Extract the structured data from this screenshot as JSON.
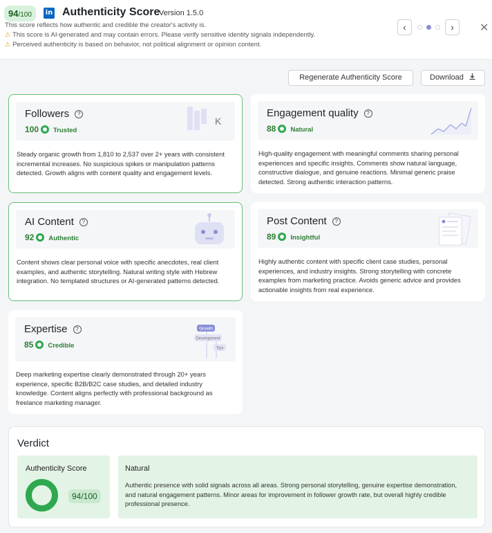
{
  "header": {
    "score_main": "94",
    "score_denominator": "/100",
    "linkedin_icon": "in",
    "title": "Authenticity Score",
    "version": "Version 1.5.0",
    "line1": "This score reflects how authentic and credible the creator's activity is.",
    "warning1": "This score is AI-generated and may contain errors. Please verify sensitive identity signals independently.",
    "warning2": "Perceived authenticity is based on behavior, not political alignment or opinion content.",
    "warning_icon": "⚠",
    "prev_icon": "‹",
    "next_icon": "›",
    "close_icon": "✕",
    "pager_active_index": 2
  },
  "actions": {
    "regenerate_label": "Regenerate Authenticity Score",
    "download_label": "Download"
  },
  "cards": {
    "followers": {
      "title": "Followers",
      "score": "100",
      "tag": "Trusted",
      "illus_letter": "K",
      "desc": "Steady organic growth from 1,810 to 2,537 over 2+ years with consistent incremental increases. No suspicious spikes or manipulation patterns detected. Growth aligns with content quality and engagement levels."
    },
    "engagement": {
      "title": "Engagement quality",
      "score": "88",
      "tag": "Natural",
      "desc": "High-quality engagement with meaningful comments sharing personal experiences and specific insights. Comments show natural language, constructive dialogue, and genuine reactions. Minimal generic praise detected. Strong authentic interaction patterns."
    },
    "ai_content": {
      "title": "AI Content",
      "score": "92",
      "tag": "Authentic",
      "desc": "Content shows clear personal voice with specific anecdotes, real client examples, and authentic storytelling. Natural writing style with Hebrew integration. No templated structures or AI-generated patterns detected."
    },
    "post_content": {
      "title": "Post Content",
      "score": "89",
      "tag": "Insightful",
      "desc": "Highly authentic content with specific client case studies, personal experiences, and industry insights. Strong storytelling with concrete examples from marketing practice. Avoids generic advice and provides actionable insights from real experience."
    },
    "expertise": {
      "title": "Expertise",
      "score": "85",
      "tag": "Credible",
      "illus_labels": [
        "Growth",
        "Development",
        "Tips"
      ],
      "desc": "Deep marketing expertise clearly demonstrated through 20+ years experience, specific B2B/B2C case studies, and detailed industry knowledge. Content aligns perfectly with professional background as freelance marketing manager."
    }
  },
  "verdict": {
    "title": "Verdict",
    "score_label": "Authenticity Score",
    "score": "94/100",
    "summary_title": "Natural",
    "summary": "Authentic presence with solid signals across all areas. Strong personal storytelling, genuine expertise demonstration, and natural engagement patterns. Minor areas for improvement in follower growth rate, but overall highly credible professional presence."
  },
  "colors": {
    "accent_green": "#2fa84f",
    "pill_green": "#d8f1dc",
    "highlight_border": "#66c178",
    "pager_active": "#8b8ed8",
    "linkedin_blue": "#0a66c2"
  }
}
